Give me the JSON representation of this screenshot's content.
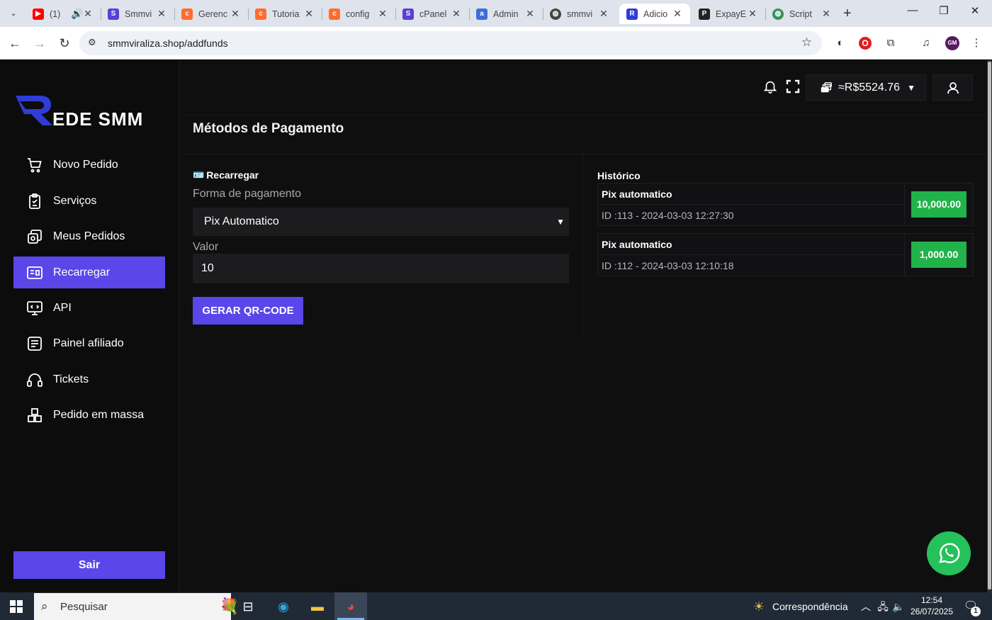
{
  "browser": {
    "tabs": [
      {
        "title": "(1)",
        "icon": "youtube-icon",
        "color": "#ff0000",
        "audio": true
      },
      {
        "title": "Smmvi",
        "icon": "smm-icon",
        "color": "#5a3fd8"
      },
      {
        "title": "Gerenc",
        "icon": "cpanel-icon",
        "color": "#ff6c2c"
      },
      {
        "title": "Tutoria",
        "icon": "cpanel-icon",
        "color": "#ff6c2c"
      },
      {
        "title": "config",
        "icon": "cpanel-icon",
        "color": "#ff6c2c"
      },
      {
        "title": "cPanel",
        "icon": "smm-icon",
        "color": "#5a3fd8"
      },
      {
        "title": "Admin",
        "icon": "admin-icon",
        "color": "#3b6fd8"
      },
      {
        "title": "smmvi",
        "icon": "globe-icon",
        "color": "#444444"
      },
      {
        "title": "Adicio",
        "icon": "rede-icon",
        "color": "#2f3cd6",
        "active": true
      },
      {
        "title": "ExpayE",
        "icon": "paypal-icon",
        "color": "#222222"
      },
      {
        "title": "Script",
        "icon": "globe-icon",
        "color": "#3a8f5a"
      }
    ],
    "url": "smmviraliza.shop/addfunds"
  },
  "sidebar": {
    "brand": "EDE SMM",
    "items": [
      {
        "label": "Novo Pedido",
        "icon": "cart-icon"
      },
      {
        "label": "Serviços",
        "icon": "clipboard-icon"
      },
      {
        "label": "Meus Pedidos",
        "icon": "orders-icon"
      },
      {
        "label": "Recarregar",
        "icon": "wallet-card-icon",
        "active": true
      },
      {
        "label": "API",
        "icon": "api-icon"
      },
      {
        "label": "Painel afiliado",
        "icon": "affiliate-icon"
      },
      {
        "label": "Tickets",
        "icon": "headset-icon"
      },
      {
        "label": "Pedido em massa",
        "icon": "mass-order-icon"
      }
    ],
    "logout": "Sair"
  },
  "topbar": {
    "balance": "≈R$5524.76"
  },
  "page": {
    "title": "Métodos de Pagamento",
    "form": {
      "section": "Recarregar",
      "method_label": "Forma de pagamento",
      "method_value": "Pix Automatico",
      "amount_label": "Valor",
      "amount_value": "10",
      "submit": "GERAR QR-CODE"
    },
    "history": {
      "heading": "Histórico",
      "entries": [
        {
          "method": "Pix automatico",
          "meta": "ID :113 - 2024-03-03 12:27:30",
          "amount": "10,000.00"
        },
        {
          "method": "Pix automatico",
          "meta": "ID :112 - 2024-03-03 12:10:18",
          "amount": "1,000.00"
        }
      ]
    }
  },
  "taskbar": {
    "search": "Pesquisar",
    "news": "Correspondência",
    "time": "12:54",
    "date": "26/07/2025",
    "notifications": "1"
  }
}
